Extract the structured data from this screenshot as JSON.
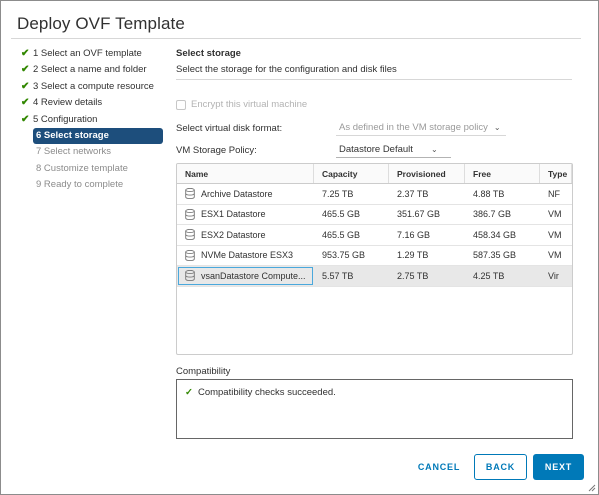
{
  "dialog": {
    "title": "Deploy OVF Template"
  },
  "steps": [
    {
      "number": "1",
      "label": "1 Select an OVF template",
      "state": "done"
    },
    {
      "number": "2",
      "label": "2 Select a name and folder",
      "state": "done"
    },
    {
      "number": "3",
      "label": "3 Select a compute resource",
      "state": "done"
    },
    {
      "number": "4",
      "label": "4 Review details",
      "state": "done"
    },
    {
      "number": "5",
      "label": "5 Configuration",
      "state": "done"
    },
    {
      "number": "6",
      "label": "6 Select storage",
      "state": "active"
    },
    {
      "number": "7",
      "label": "7 Select networks",
      "state": "todo"
    },
    {
      "number": "8",
      "label": "8 Customize template",
      "state": "todo"
    },
    {
      "number": "9",
      "label": "9 Ready to complete",
      "state": "todo"
    }
  ],
  "section": {
    "title": "Select storage",
    "description": "Select the storage for the configuration and disk files"
  },
  "encrypt": {
    "label": "Encrypt this virtual machine",
    "checked": false,
    "disabled": true
  },
  "disk_format": {
    "label": "Select virtual disk format:",
    "value": "As defined in the VM storage policy"
  },
  "storage_policy": {
    "label": "VM Storage Policy:",
    "value": "Datastore Default"
  },
  "grid": {
    "columns": [
      "Name",
      "Capacity",
      "Provisioned",
      "Free",
      "Type"
    ],
    "rows": [
      {
        "name": "Archive Datastore",
        "capacity": "7.25 TB",
        "provisioned": "2.37 TB",
        "free": "4.88 TB",
        "type": "NF"
      },
      {
        "name": "ESX1 Datastore",
        "capacity": "465.5 GB",
        "provisioned": "351.67 GB",
        "free": "386.7 GB",
        "type": "VM"
      },
      {
        "name": "ESX2 Datastore",
        "capacity": "465.5 GB",
        "provisioned": "7.16 GB",
        "free": "458.34 GB",
        "type": "VM"
      },
      {
        "name": "NVMe Datastore ESX3",
        "capacity": "953.75 GB",
        "provisioned": "1.29 TB",
        "free": "587.35 GB",
        "type": "VM"
      },
      {
        "name": "vsanDatastore Compute...",
        "capacity": "5.57 TB",
        "provisioned": "2.75 TB",
        "free": "4.25 TB",
        "type": "Vir",
        "selected": true
      }
    ]
  },
  "compatibility": {
    "label": "Compatibility",
    "message": "Compatibility checks succeeded."
  },
  "buttons": {
    "cancel": "CANCEL",
    "back": "BACK",
    "next": "NEXT"
  },
  "colors": {
    "accent": "#0079b8",
    "active_step": "#1d4e7c",
    "success": "#318700"
  }
}
